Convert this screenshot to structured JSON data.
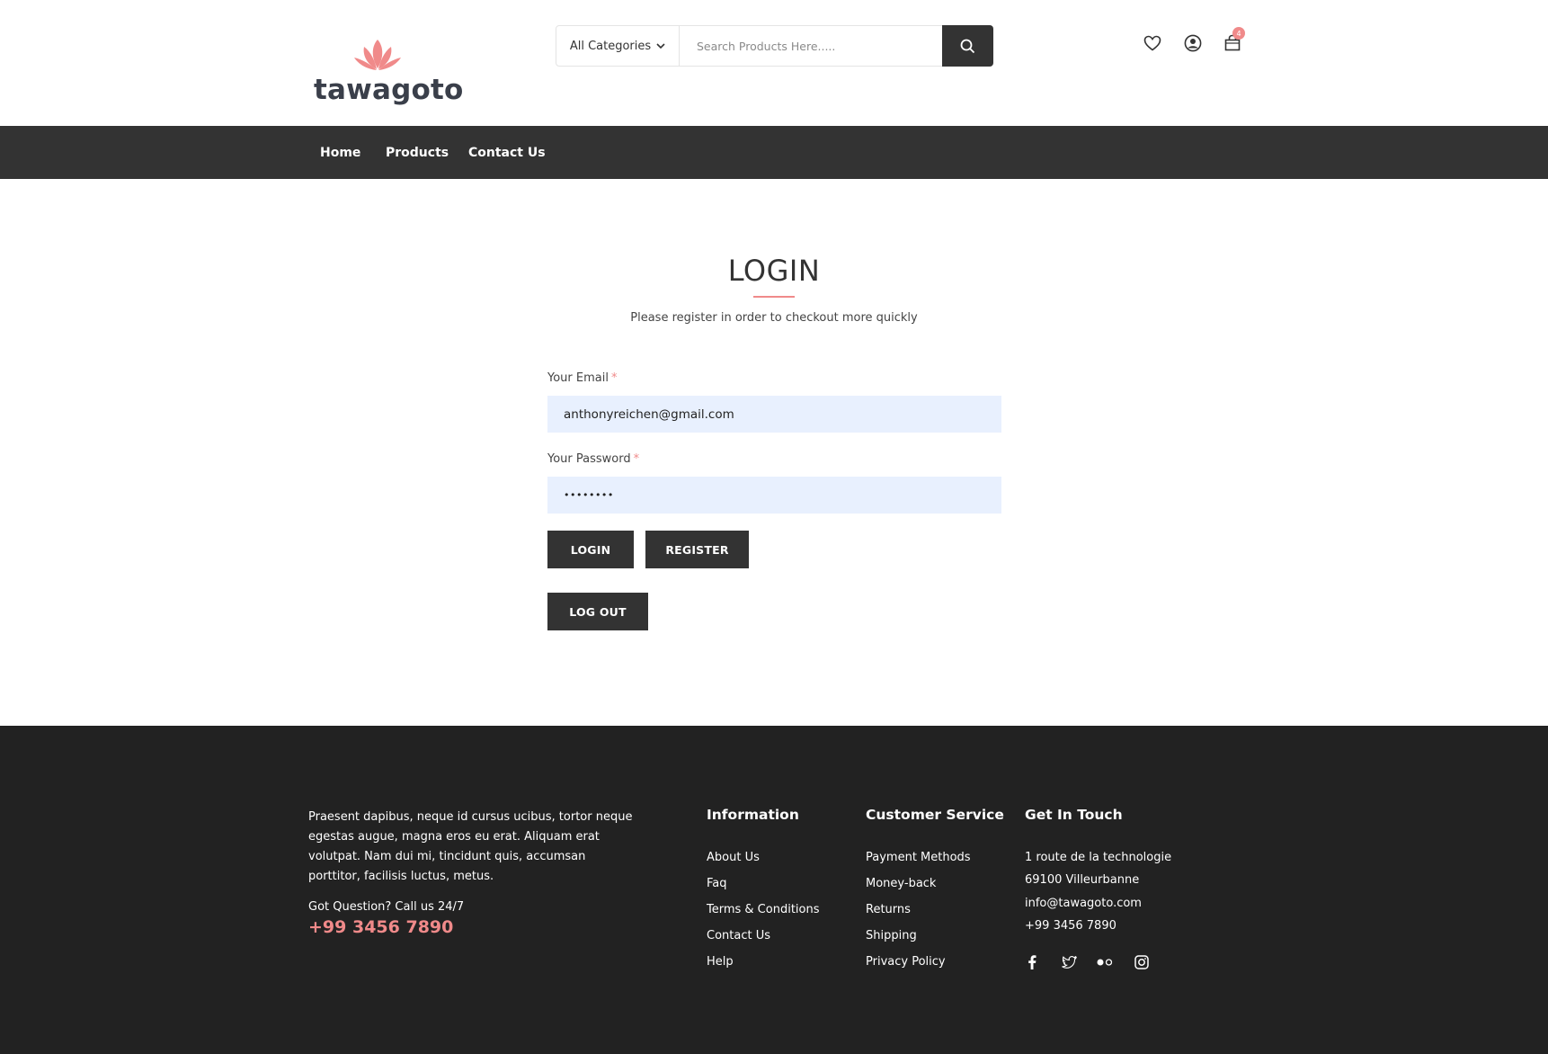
{
  "brand": {
    "name": "tawagoto",
    "accent_color": "#f08a8a",
    "dark_color": "#333333"
  },
  "header": {
    "category_label": "All Categories",
    "search_placeholder": "Search Products Here.....",
    "icons": [
      "search-icon",
      "heart-icon",
      "user-icon",
      "cart-icon"
    ],
    "cart_count": "4"
  },
  "nav": {
    "items": [
      {
        "label": "Home"
      },
      {
        "label": "Products"
      },
      {
        "label": "Contact Us"
      }
    ]
  },
  "login": {
    "title": "LOGIN",
    "subtitle": "Please register in order to checkout more quickly",
    "email_label": "Your Email",
    "email_value": "anthonyreichen@gmail.com",
    "password_label": "Your Password",
    "password_value": "••••••••",
    "required_mark": "*",
    "login_button": "LOGIN",
    "register_button": "REGISTER",
    "logout_button": "LOG OUT"
  },
  "footer": {
    "about": "Praesent dapibus, neque id cursus ucibus, tortor neque egestas augue, magna eros eu erat. Aliquam erat volutpat. Nam dui mi, tincidunt quis, accumsan porttitor, facilisis luctus, metus.",
    "question": "Got Question? Call us 24/7",
    "phone": "+99 3456 7890",
    "information": {
      "title": "Information",
      "links": [
        "About Us",
        "Faq",
        "Terms & Conditions",
        "Contact Us",
        "Help"
      ]
    },
    "customer_service": {
      "title": "Customer Service",
      "links": [
        "Payment Methods",
        "Money-back",
        "Returns",
        "Shipping",
        "Privacy Policy"
      ]
    },
    "get_in_touch": {
      "title": "Get In Touch",
      "lines": [
        "1 route de la technologie",
        "69100 Villeurbanne",
        "info@tawagoto.com",
        "+99 3456 7890"
      ],
      "social_icons": [
        "facebook-icon",
        "twitter-icon",
        "flickr-icon",
        "instagram-icon"
      ]
    }
  }
}
